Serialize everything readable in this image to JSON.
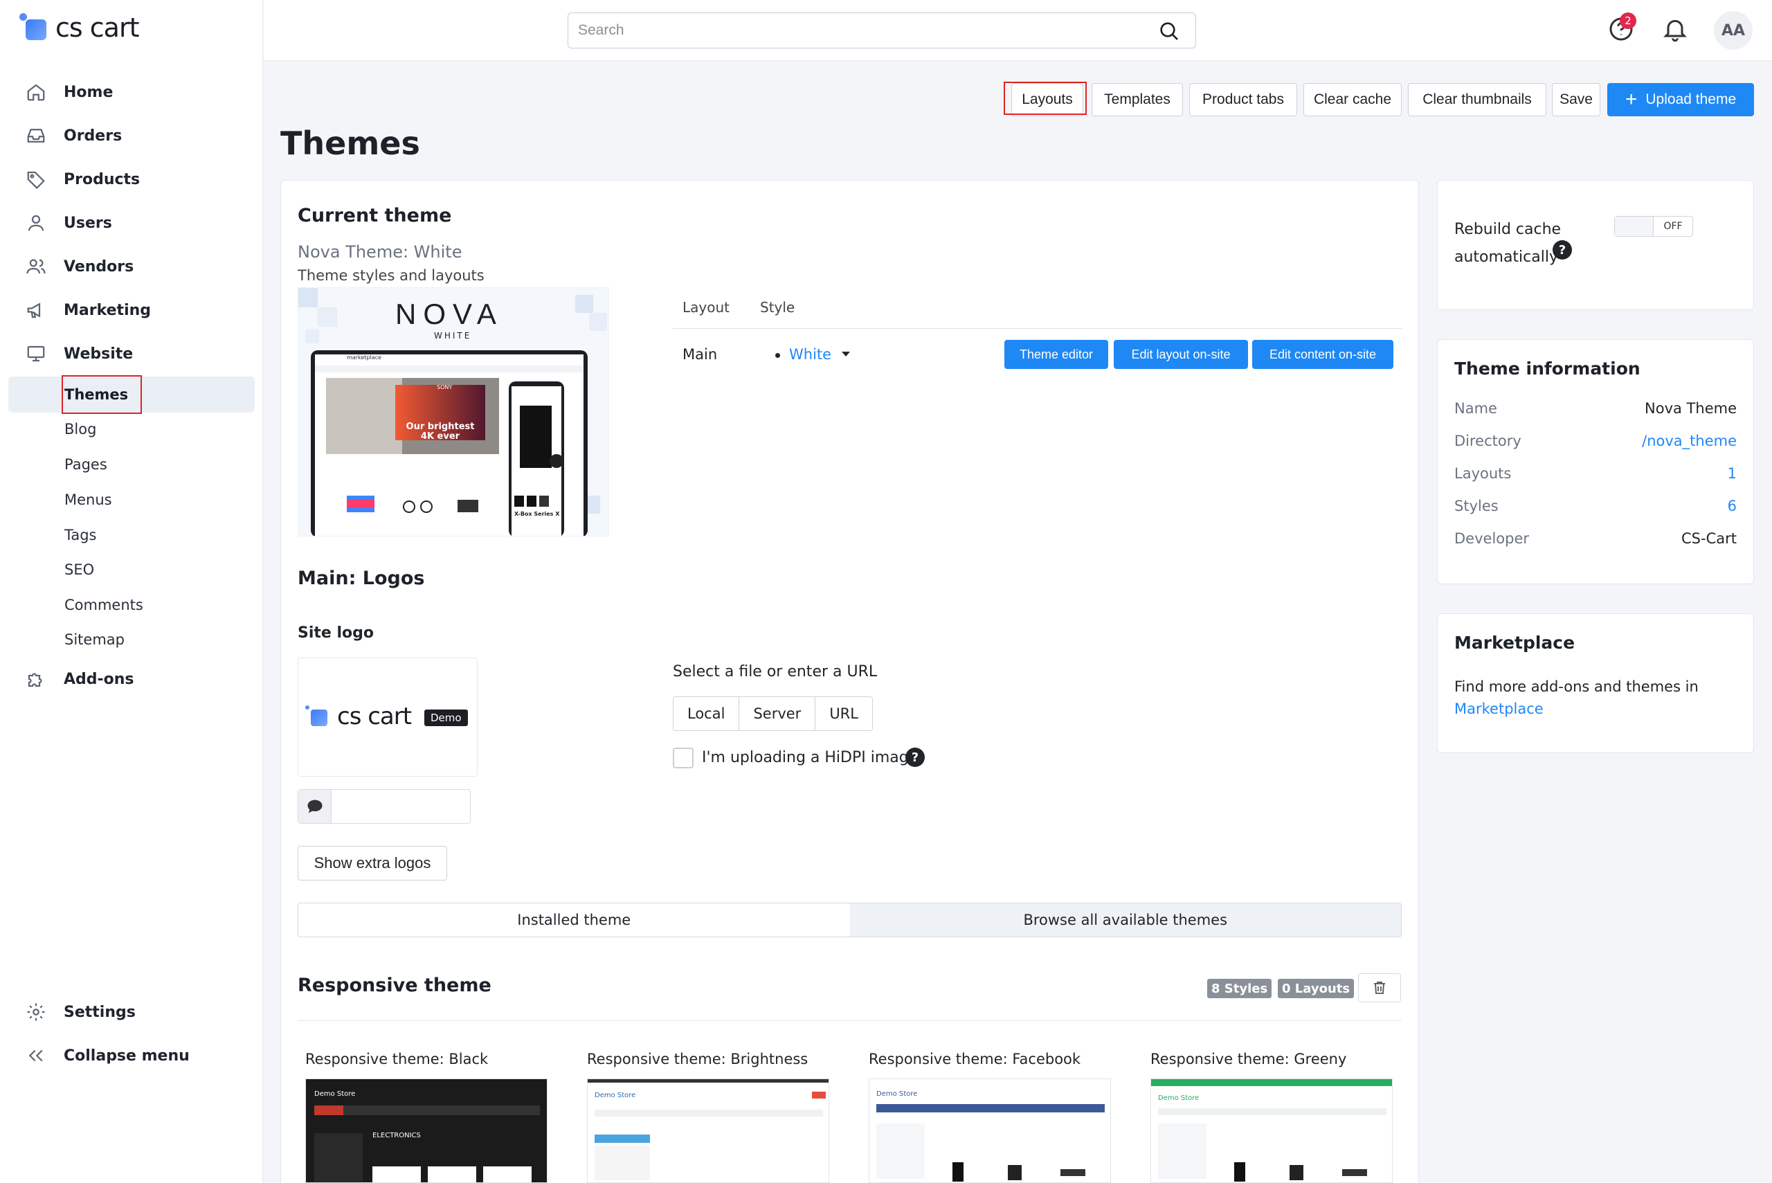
{
  "app": {
    "name": "cs cart"
  },
  "sidebar": {
    "items": [
      {
        "label": "Home",
        "icon": "home-icon"
      },
      {
        "label": "Orders",
        "icon": "inbox-icon"
      },
      {
        "label": "Products",
        "icon": "tag-icon"
      },
      {
        "label": "Users",
        "icon": "user-icon"
      },
      {
        "label": "Vendors",
        "icon": "users-icon"
      },
      {
        "label": "Marketing",
        "icon": "megaphone-icon"
      },
      {
        "label": "Website",
        "icon": "monitor-icon"
      }
    ],
    "website_sub": [
      "Themes",
      "Blog",
      "Pages",
      "Menus",
      "Tags",
      "SEO",
      "Comments",
      "Sitemap"
    ],
    "addons": "Add-ons",
    "settings": "Settings",
    "collapse": "Collapse menu"
  },
  "header": {
    "search_placeholder": "Search",
    "notification_count": "2",
    "avatar_initials": "AA"
  },
  "toolbar": {
    "layouts": "Layouts",
    "templates": "Templates",
    "product_tabs": "Product tabs",
    "clear_cache": "Clear cache",
    "clear_thumbnails": "Clear thumbnails",
    "save": "Save",
    "upload_theme": "Upload theme"
  },
  "page": {
    "title": "Themes"
  },
  "current_theme": {
    "heading": "Current theme",
    "name": "Nova Theme: White",
    "subtitle": "Theme styles and layouts",
    "preview_brand": "NOVA",
    "preview_sub": "WHITE",
    "preview_store": "marketplace",
    "preview_promo": "Our brightest 4K ever",
    "preview_product": "X-Box Series X",
    "preview_tv_brand": "SONY",
    "table_headers": {
      "layout": "Layout",
      "style": "Style"
    },
    "row": {
      "layout": "Main",
      "style": "White"
    },
    "buttons": {
      "theme_editor": "Theme editor",
      "edit_layout": "Edit layout on-site",
      "edit_content": "Edit content on-site"
    }
  },
  "logos": {
    "heading": "Main: Logos",
    "site_logo": "Site logo",
    "logo_text": "cs cart",
    "logo_badge": "Demo",
    "select_label": "Select a file or enter a URL",
    "sources": [
      "Local",
      "Server",
      "URL"
    ],
    "hidpi_label": "I'm uploading a HiDPI image.",
    "show_extra": "Show extra logos"
  },
  "theme_tabs": {
    "installed": "Installed theme",
    "browse": "Browse all available themes"
  },
  "responsive": {
    "heading": "Responsive theme",
    "styles_badge": "8 Styles",
    "layouts_badge": "0 Layouts",
    "thumbs": [
      {
        "title": "Responsive theme: Black",
        "accent": "#c0392b",
        "bg": "#1b1b1b"
      },
      {
        "title": "Responsive theme: Brightness",
        "accent": "#e74c3c",
        "bg": "#ffffff"
      },
      {
        "title": "Responsive theme: Facebook",
        "accent": "#3b5998",
        "bg": "#ffffff"
      },
      {
        "title": "Responsive theme: Greeny",
        "accent": "#27ae60",
        "bg": "#ffffff"
      }
    ],
    "thumb_store": "Demo Store",
    "thumb_section": "ELECTRONICS"
  },
  "rebuild": {
    "label": "Rebuild cache automatically",
    "toggle": "OFF"
  },
  "theme_info": {
    "heading": "Theme information",
    "rows": [
      {
        "label": "Name",
        "value": "Nova Theme"
      },
      {
        "label": "Directory",
        "value": "/nova_theme"
      },
      {
        "label": "Layouts",
        "value": "1"
      },
      {
        "label": "Styles",
        "value": "6"
      },
      {
        "label": "Developer",
        "value": "CS-Cart"
      }
    ]
  },
  "marketplace": {
    "heading": "Marketplace",
    "text": "Find more add-ons and themes in",
    "link": "Marketplace"
  },
  "colors": {
    "accent": "#1e88f5",
    "highlight": "#e02424",
    "badge": "#e0284d"
  }
}
